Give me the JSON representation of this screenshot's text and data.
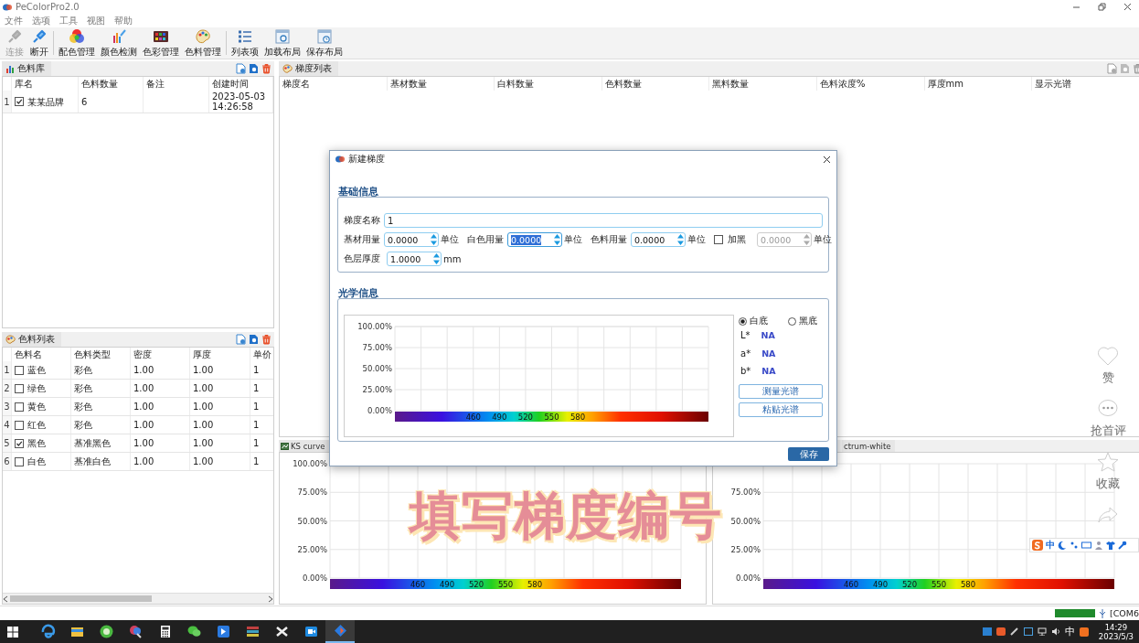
{
  "window": {
    "title": "PeColorPro2.0"
  },
  "menu": [
    "文件",
    "选项",
    "工具",
    "视图",
    "帮助"
  ],
  "toolbar_groups": [
    {
      "buttons": [
        {
          "label": "连接",
          "disabled": true
        },
        {
          "label": "断开",
          "disabled": false
        }
      ]
    },
    {
      "buttons": [
        {
          "label": "配色管理",
          "disabled": false
        },
        {
          "label": "颜色检测",
          "disabled": false
        },
        {
          "label": "色彩管理",
          "disabled": false
        },
        {
          "label": "色料管理",
          "disabled": false
        }
      ]
    },
    {
      "buttons": [
        {
          "label": "列表项",
          "disabled": false
        },
        {
          "label": "加载布局",
          "disabled": false
        },
        {
          "label": "保存布局",
          "disabled": false
        }
      ]
    }
  ],
  "library_panel": {
    "title": "色料库",
    "tools_disabled": false,
    "columns": [
      "库名",
      "色料数量",
      "备注",
      "创建时间"
    ],
    "rows": [
      {
        "number": "1",
        "checked": true,
        "name": "某某品牌",
        "count": "6",
        "created": "2023-05-03 14:26:58"
      }
    ]
  },
  "pigment_panel": {
    "title": "色料列表",
    "tools_disabled": false,
    "columns": [
      "色料名",
      "色料类型",
      "密度",
      "厚度",
      "单价"
    ],
    "rows": [
      {
        "number": "1",
        "checked": false,
        "name": "蓝色",
        "type": "彩色",
        "density": "1.00",
        "thickness": "1.00",
        "price": "1"
      },
      {
        "number": "2",
        "checked": false,
        "name": "绿色",
        "type": "彩色",
        "density": "1.00",
        "thickness": "1.00",
        "price": "1"
      },
      {
        "number": "3",
        "checked": false,
        "name": "黄色",
        "type": "彩色",
        "density": "1.00",
        "thickness": "1.00",
        "price": "1"
      },
      {
        "number": "4",
        "checked": false,
        "name": "红色",
        "type": "彩色",
        "density": "1.00",
        "thickness": "1.00",
        "price": "1"
      },
      {
        "number": "5",
        "checked": true,
        "name": "黑色",
        "type": "基准黑色",
        "density": "1.00",
        "thickness": "1.00",
        "price": "1"
      },
      {
        "number": "6",
        "checked": false,
        "name": "白色",
        "type": "基准白色",
        "density": "1.00",
        "thickness": "1.00",
        "price": "1"
      }
    ]
  },
  "gradient_panel": {
    "title": "梯度列表",
    "tools_disabled": true,
    "columns": [
      "梯度名",
      "基材数量",
      "白料数量",
      "色料数量",
      "黑料数量",
      "色料浓度%",
      "厚度mm",
      "显示光谱"
    ]
  },
  "ks_chart": {
    "tab": "KS curve",
    "chart_data": {
      "type": "line",
      "grid": true,
      "xlim": [
        370,
        730
      ],
      "ylim": [
        0,
        1
      ],
      "xticks": [
        460,
        490,
        520,
        550,
        580
      ],
      "yticks": [
        {
          "value": 0,
          "label": "0.00%"
        },
        {
          "value": 0.25,
          "label": "25.00%"
        },
        {
          "value": 0.5,
          "label": "50.00%"
        },
        {
          "value": 0.75,
          "label": "75.00%"
        },
        {
          "value": 1,
          "label": "100.00%"
        }
      ]
    }
  },
  "spectrum_chart": {
    "tab": "ctrum-white",
    "chart_data": {
      "type": "line",
      "grid": true,
      "xlim": [
        370,
        730
      ],
      "ylim": [
        0,
        1
      ],
      "xticks": [
        460,
        490,
        520,
        550,
        580
      ],
      "yticks": [
        {
          "value": 0,
          "label": "0.00%"
        },
        {
          "value": 0.25,
          "label": "25.00%"
        },
        {
          "value": 0.5,
          "label": "50.00%"
        },
        {
          "value": 0.75,
          "label": "75.00%"
        }
      ]
    }
  },
  "dialog": {
    "title": "新建梯度",
    "basic_section": {
      "title": "基础信息",
      "name_field": {
        "label": "梯度名称",
        "value": "1"
      },
      "amounts": [
        {
          "kind": "label",
          "label": "基材用量",
          "value": "0.0000",
          "unit": "单位",
          "focused": false,
          "disabled": false
        },
        {
          "kind": "label",
          "label": "白色用量",
          "value": "0.0000",
          "unit": "单位",
          "focused": true,
          "disabled": false
        },
        {
          "kind": "label",
          "label": "色料用量",
          "value": "0.0000",
          "unit": "单位",
          "focused": false,
          "disabled": false
        },
        {
          "kind": "checkbox",
          "label": "加黑",
          "checked": false,
          "value": "0.0000",
          "unit": "单位",
          "focused": false,
          "disabled": true
        }
      ],
      "thickness": {
        "label": "色层厚度",
        "value": "1.0000",
        "unit": "mm"
      }
    },
    "optical_section": {
      "title": "光学信息",
      "chart_data": {
        "type": "line",
        "grid": true,
        "xlim": [
          370,
          730
        ],
        "ylim": [
          0,
          1
        ],
        "xticks": [
          460,
          490,
          520,
          550,
          580
        ],
        "yticks": [
          {
            "value": 0,
            "label": "0.00%"
          },
          {
            "value": 0.25,
            "label": "25.00%"
          },
          {
            "value": 0.5,
            "label": "50.00%"
          },
          {
            "value": 0.75,
            "label": "75.00%"
          },
          {
            "value": 1,
            "label": "100.00%"
          }
        ]
      },
      "backgrounds": [
        {
          "label": "白底",
          "selected": true
        },
        {
          "label": "黑底",
          "selected": false
        }
      ],
      "lab": [
        {
          "label": "L*",
          "value": "NA"
        },
        {
          "label": "a*",
          "value": "NA"
        },
        {
          "label": "b*",
          "value": "NA"
        }
      ],
      "buttons": [
        "测量光谱",
        "粘贴光谱"
      ]
    },
    "save": "保存"
  },
  "video_caption": "填写梯度编号",
  "video_actions": [
    "赞",
    "抢首评",
    "收藏"
  ],
  "ime_bar": {
    "mode": "中"
  },
  "status_bar": {
    "port": "[COM6"
  },
  "taskbar": {
    "apps": [
      {
        "selected": false
      },
      {
        "selected": false
      },
      {
        "selected": false
      },
      {
        "selected": false
      },
      {
        "selected": false
      },
      {
        "selected": false
      },
      {
        "selected": false
      },
      {
        "selected": false
      },
      {
        "selected": false
      },
      {
        "selected": false
      },
      {
        "selected": true
      }
    ],
    "ime": "中",
    "time": "14:29",
    "date": "2023/5/3"
  }
}
